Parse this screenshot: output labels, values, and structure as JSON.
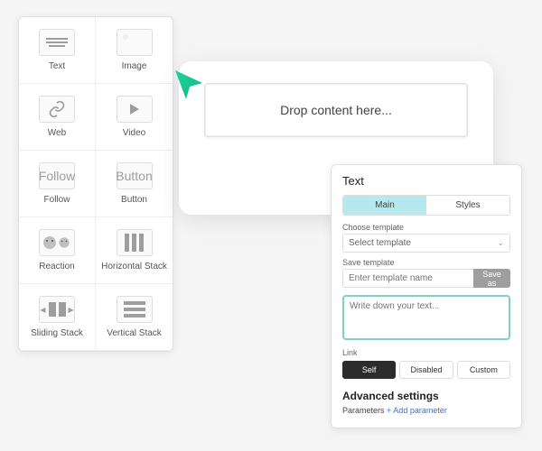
{
  "palette": {
    "items": [
      {
        "label": "Text",
        "icon": "text"
      },
      {
        "label": "Image",
        "icon": "image"
      },
      {
        "label": "Web",
        "icon": "web"
      },
      {
        "label": "Video",
        "icon": "video"
      },
      {
        "label": "Follow",
        "icon": "follow",
        "thumb_text": "Follow"
      },
      {
        "label": "Button",
        "icon": "button",
        "thumb_text": "Button"
      },
      {
        "label": "Reaction",
        "icon": "reaction"
      },
      {
        "label": "Horizontal Stack",
        "icon": "hstack"
      },
      {
        "label": "Sliding Stack",
        "icon": "sliding"
      },
      {
        "label": "Vertical Stack",
        "icon": "vstack"
      }
    ]
  },
  "canvas": {
    "dropzone_text": "Drop content here..."
  },
  "props": {
    "title": "Text",
    "tabs": {
      "main": "Main",
      "styles": "Styles"
    },
    "choose_template_label": "Choose template",
    "choose_template_value": "Select template",
    "save_template_label": "Save template",
    "save_template_placeholder": "Enter template name",
    "save_as_label": "Save as",
    "textarea_placeholder": "Write down your text...",
    "link_label": "Link",
    "link_options": {
      "self": "Self",
      "disabled": "Disabled",
      "custom": "Custom"
    },
    "advanced_settings": "Advanced settings",
    "parameters_label": "Parameters",
    "add_parameter": "+ Add parameter"
  }
}
